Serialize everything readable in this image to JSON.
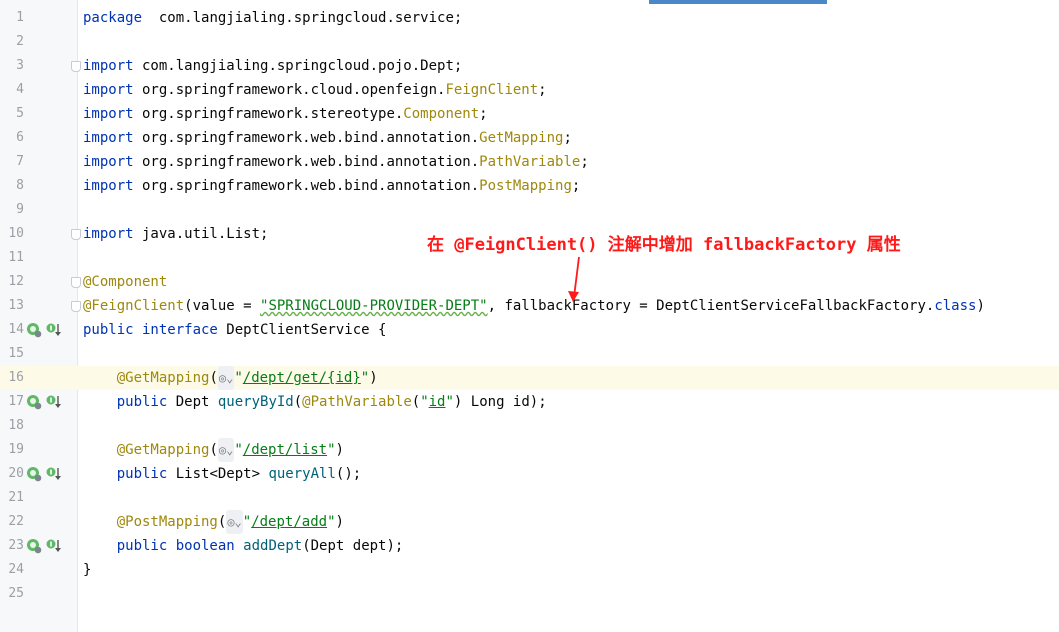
{
  "code_lines": [
    {
      "n": "1",
      "t": [
        [
          "kw",
          "package"
        ],
        [
          "",
          "  com.langjialing.springcloud.service;"
        ]
      ]
    },
    {
      "n": "2",
      "t": []
    },
    {
      "n": "3",
      "t": [
        [
          "kw",
          "import"
        ],
        [
          "",
          " com.langjialing.springcloud.pojo.Dept;"
        ]
      ]
    },
    {
      "n": "4",
      "t": [
        [
          "kw",
          "import"
        ],
        [
          "",
          " org.springframework.cloud.openfeign."
        ],
        [
          "cls",
          "FeignClient"
        ],
        [
          "",
          ";"
        ]
      ]
    },
    {
      "n": "5",
      "t": [
        [
          "kw",
          "import"
        ],
        [
          "",
          " org.springframework.stereotype."
        ],
        [
          "cls",
          "Component"
        ],
        [
          "",
          ";"
        ]
      ]
    },
    {
      "n": "6",
      "t": [
        [
          "kw",
          "import"
        ],
        [
          "",
          " org.springframework.web.bind.annotation."
        ],
        [
          "cls",
          "GetMapping"
        ],
        [
          "",
          ";"
        ]
      ]
    },
    {
      "n": "7",
      "t": [
        [
          "kw",
          "import"
        ],
        [
          "",
          " org.springframework.web.bind.annotation."
        ],
        [
          "cls",
          "PathVariable"
        ],
        [
          "",
          ";"
        ]
      ]
    },
    {
      "n": "8",
      "t": [
        [
          "kw",
          "import"
        ],
        [
          "",
          " org.springframework.web.bind.annotation."
        ],
        [
          "cls",
          "PostMapping"
        ],
        [
          "",
          ";"
        ]
      ]
    },
    {
      "n": "9",
      "t": []
    },
    {
      "n": "10",
      "t": [
        [
          "kw",
          "import"
        ],
        [
          "",
          " java.util.List;"
        ]
      ]
    },
    {
      "n": "11",
      "t": []
    },
    {
      "n": "12",
      "t": [
        [
          "ann",
          "@Component"
        ]
      ]
    },
    {
      "n": "13",
      "t": [
        [
          "ann",
          "@FeignClient"
        ],
        [
          "",
          "(value = "
        ],
        [
          "str",
          "\"SPRINGCLOUD-PROVIDER-DEPT\""
        ],
        [
          "",
          ", fallbackFactory = DeptClientServiceFallbackFactory."
        ],
        [
          "kw",
          "class"
        ],
        [
          "",
          ")"
        ]
      ]
    },
    {
      "n": "14",
      "t": [
        [
          "kw",
          "public interface"
        ],
        [
          "",
          " DeptClientService {"
        ]
      ]
    },
    {
      "n": "15",
      "t": []
    },
    {
      "n": "16",
      "t": [
        [
          "",
          "    "
        ],
        [
          "ann",
          "@GetMapping"
        ],
        [
          "",
          "("
        ],
        [
          "globe",
          "◎⌄"
        ],
        [
          "str",
          "\""
        ],
        [
          "link",
          "/dept/get/{id}"
        ],
        [
          "str",
          "\""
        ],
        [
          "",
          ")"
        ]
      ]
    },
    {
      "n": "17",
      "t": [
        [
          "",
          "    "
        ],
        [
          "kw",
          "public"
        ],
        [
          "",
          " Dept "
        ],
        [
          "meth",
          "queryById"
        ],
        [
          "",
          "("
        ],
        [
          "ann",
          "@PathVariable"
        ],
        [
          "",
          "("
        ],
        [
          "str",
          "\""
        ],
        [
          "link",
          "id"
        ],
        [
          "str",
          "\""
        ],
        [
          "",
          ") Long id);"
        ]
      ]
    },
    {
      "n": "18",
      "t": []
    },
    {
      "n": "19",
      "t": [
        [
          "",
          "    "
        ],
        [
          "ann",
          "@GetMapping"
        ],
        [
          "",
          "("
        ],
        [
          "globe",
          "◎⌄"
        ],
        [
          "str",
          "\""
        ],
        [
          "link",
          "/dept/list"
        ],
        [
          "str",
          "\""
        ],
        [
          "",
          ")"
        ]
      ]
    },
    {
      "n": "20",
      "t": [
        [
          "",
          "    "
        ],
        [
          "kw",
          "public"
        ],
        [
          "",
          " List<Dept> "
        ],
        [
          "meth",
          "queryAll"
        ],
        [
          "",
          "();"
        ]
      ]
    },
    {
      "n": "21",
      "t": []
    },
    {
      "n": "22",
      "t": [
        [
          "",
          "    "
        ],
        [
          "ann",
          "@PostMapping"
        ],
        [
          "",
          "("
        ],
        [
          "globe",
          "◎⌄"
        ],
        [
          "str",
          "\""
        ],
        [
          "link",
          "/dept/add"
        ],
        [
          "str",
          "\""
        ],
        [
          "",
          ")"
        ]
      ]
    },
    {
      "n": "23",
      "t": [
        [
          "",
          "    "
        ],
        [
          "kw",
          "public boolean"
        ],
        [
          "",
          " "
        ],
        [
          "meth",
          "addDept"
        ],
        [
          "",
          "(Dept dept);"
        ]
      ]
    },
    {
      "n": "24",
      "t": [
        [
          "",
          "}"
        ]
      ]
    },
    {
      "n": "25",
      "t": []
    }
  ],
  "fold_lines": [
    "3",
    "10",
    "12",
    "13"
  ],
  "impl_icon_lines": [
    "14",
    "17",
    "20",
    "23"
  ],
  "current_line": "16",
  "annotation": {
    "text": "在 @FeignClient() 注解中增加 fallbackFactory 属性",
    "color": "#ff1a1a"
  },
  "colors": {
    "keyword": "#0033b3",
    "annotation": "#9e880d",
    "string": "#067d17",
    "method": "#00627a"
  }
}
